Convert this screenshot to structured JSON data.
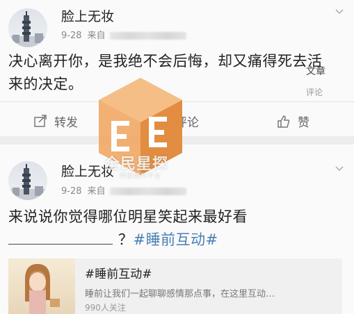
{
  "posts": [
    {
      "username": "脸上无妆",
      "date": "9-28",
      "source_label": "来自",
      "text": "决心离开你，是我绝不会后悔，却又痛得死去活来的决定。",
      "side_tag_article": "文章",
      "side_tag_comment": "评论",
      "actions": {
        "repost": "转发",
        "comment": "评论",
        "like": "赞"
      }
    },
    {
      "username": "脸上无妆",
      "date": "9-28",
      "source_label": "来自",
      "text_line1": "来说说你觉得哪位明星笑起来最好看",
      "text_line2_suffix": "？",
      "hashtag": "#睡前互动#",
      "share": {
        "title": "#睡前互动#",
        "description": "睡前让我们一起聊聊感情那点事，在这里互动…",
        "count": "990人关注"
      }
    }
  ],
  "watermark": {
    "text": "全民星探",
    "subtext": "明星爆料平台"
  },
  "colors": {
    "hashtag": "#4a7fb5",
    "watermark_orange": "#f0a25a",
    "background": "#ededed",
    "card": "#fafafa"
  }
}
